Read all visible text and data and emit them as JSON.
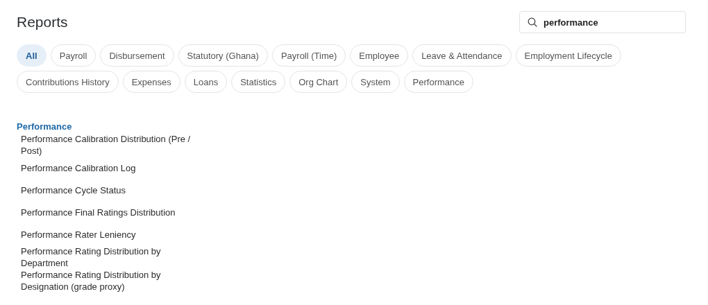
{
  "page": {
    "title": "Reports"
  },
  "search": {
    "value": "performance"
  },
  "filters": [
    {
      "label": "All",
      "selected": true
    },
    {
      "label": "Payroll",
      "selected": false
    },
    {
      "label": "Disbursement",
      "selected": false
    },
    {
      "label": "Statutory (Ghana)",
      "selected": false
    },
    {
      "label": "Payroll (Time)",
      "selected": false
    },
    {
      "label": "Employee",
      "selected": false
    },
    {
      "label": "Leave & Attendance",
      "selected": false
    },
    {
      "label": "Employment Lifecycle",
      "selected": false
    },
    {
      "label": "Contributions History",
      "selected": false
    },
    {
      "label": "Expenses",
      "selected": false
    },
    {
      "label": "Loans",
      "selected": false
    },
    {
      "label": "Statistics",
      "selected": false
    },
    {
      "label": "Org Chart",
      "selected": false
    },
    {
      "label": "System",
      "selected": false
    },
    {
      "label": "Performance",
      "selected": false
    }
  ],
  "sections": [
    {
      "title": "Performance",
      "reports": [
        "Performance Calibration Distribution (Pre / Post)",
        "Performance Calibration Log",
        "Performance Cycle Status",
        "Performance Final Ratings Distribution",
        "Performance Rater Leniency",
        "Performance Rating Distribution by Department",
        "Performance Rating Distribution by Designation (grade proxy)"
      ]
    }
  ]
}
